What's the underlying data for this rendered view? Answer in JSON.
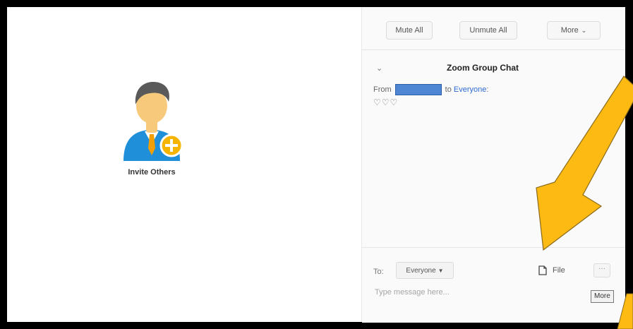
{
  "left_pane": {
    "invite_label": "Invite Others"
  },
  "toolbar": {
    "mute_all_label": "Mute All",
    "unmute_all_label": "Unmute All",
    "more_label": "More",
    "more_icon": "chevron-down-icon"
  },
  "chat": {
    "title": "Zoom Group Chat",
    "collapse_icon": "chevron-down-icon",
    "messages": [
      {
        "from_prefix": "From",
        "to_text": "to",
        "recipient": "Everyone",
        "text": "♡♡♡"
      }
    ]
  },
  "compose": {
    "to_label": "To:",
    "recipient_select": "Everyone",
    "file_label": "File",
    "file_icon": "file-icon",
    "more_button": "···",
    "more_tooltip": "More",
    "placeholder": "Type message here..."
  },
  "annotation": {
    "arrow_color": "#FDBA12",
    "arrow_outline": "#8a6a1a",
    "avatar_colors": {
      "shirt": "#1e8fd8",
      "skin": "#f7c97a",
      "hair": "#5a5a5a",
      "badge": "#f4b400"
    }
  }
}
